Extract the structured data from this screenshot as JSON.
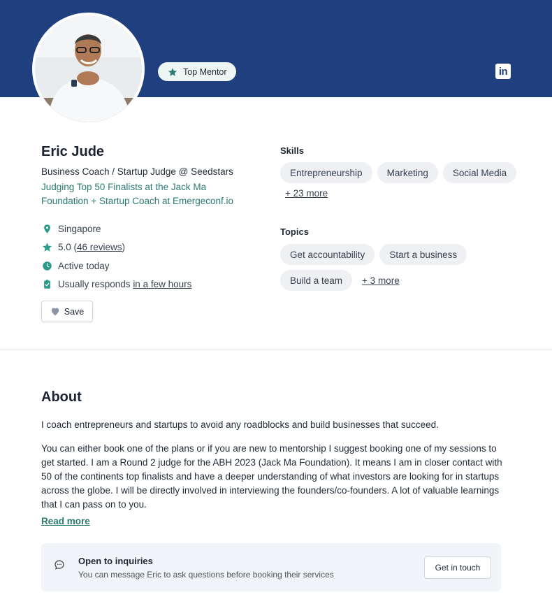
{
  "colors": {
    "banner": "#1f3f7f",
    "accent": "#2a7a70",
    "chip_bg": "#eef0f3",
    "panel_bg": "#f1f4f8"
  },
  "badge": {
    "label": "Top Mentor",
    "icon": "star-icon"
  },
  "social": {
    "icon": "linkedin-icon"
  },
  "profile": {
    "name": "Eric Jude",
    "headline": "Business Coach / Startup Judge @ Seedstars",
    "tagline": "Judging Top 50 Finalists at the Jack Ma Foundation + Startup Coach at Emergeconf.io"
  },
  "facts": {
    "location": "Singapore",
    "rating_value": "5.0 (",
    "reviews_link": "46 reviews",
    "rating_close": ")",
    "activity": "Active today",
    "responds_prefix": "Usually responds ",
    "responds_link": "in a few hours"
  },
  "save_label": "Save",
  "skills": {
    "label": "Skills",
    "items": [
      "Entrepreneurship",
      "Marketing",
      "Social Media"
    ],
    "more": "+ 23 more"
  },
  "topics": {
    "label": "Topics",
    "items": [
      "Get accountability",
      "Start a business",
      "Build a team"
    ],
    "more": "+ 3 more"
  },
  "about": {
    "title": "About",
    "p1": "I coach entrepreneurs and startups to avoid any roadblocks and build businesses that succeed.",
    "p2": "You can either book one of the plans or if you are new to mentorship I suggest booking one of my sessions to get started. I am a Round 2 judge for the ABH 2023 (Jack Ma Foundation). It means I am in closer contact with 50 of the continents top finalists and have a deeper understanding of what investors are looking for in startups across the globe. I will be directly involved in interviewing the founders/co-founders. A lot of valuable learnings that I can pass on to you.",
    "read_more": "Read more"
  },
  "inquiry": {
    "title": "Open to inquiries",
    "subtitle": "You can message Eric to ask questions before booking their services",
    "button": "Get in touch"
  }
}
